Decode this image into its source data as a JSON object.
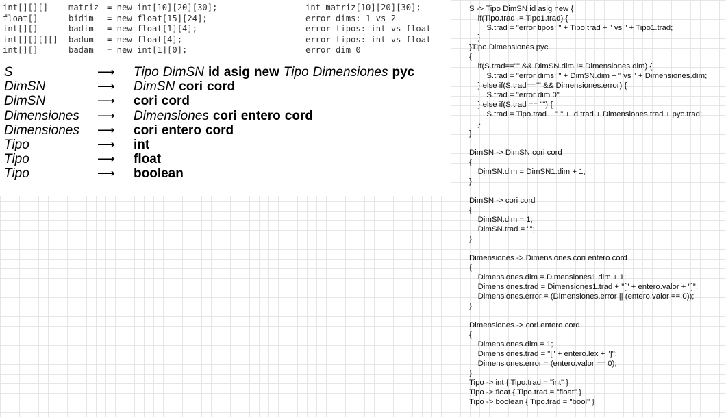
{
  "declarations": [
    {
      "type": "int[][][]",
      "name": "matriz",
      "expr": "= new int[10][20][30];",
      "result": "int matriz[10][20][30];"
    },
    {
      "type": "float[]",
      "name": "bidim",
      "expr": "= new float[15][24];",
      "result": "error dims: 1 vs 2"
    },
    {
      "type": "int[][]",
      "name": "badim",
      "expr": "= new float[1][4];",
      "result": "error tipos: int vs float"
    },
    {
      "type": "int[][][][]",
      "name": "badum",
      "expr": "= new float[4];",
      "result": "error tipos: int vs float"
    },
    {
      "type": "int[][]",
      "name": "badam",
      "expr": "= new int[1][0];",
      "result": "error dim 0"
    }
  ],
  "grammar": [
    {
      "lhs": "S",
      "arrow": "⟶",
      "rhs": [
        {
          "t": "Tipo",
          "k": "nt"
        },
        {
          "t": "DimSN",
          "k": "nt"
        },
        {
          "t": "id",
          "k": "t"
        },
        {
          "t": "asig",
          "k": "t"
        },
        {
          "t": "new",
          "k": "t"
        },
        {
          "t": "Tipo",
          "k": "nt"
        },
        {
          "t": "Dimensiones",
          "k": "nt"
        },
        {
          "t": "pyc",
          "k": "t"
        }
      ]
    },
    {
      "lhs": "DimSN",
      "arrow": "⟶",
      "rhs": [
        {
          "t": "DimSN",
          "k": "nt"
        },
        {
          "t": "cori",
          "k": "t"
        },
        {
          "t": "cord",
          "k": "t"
        }
      ]
    },
    {
      "lhs": "DimSN",
      "arrow": "⟶",
      "rhs": [
        {
          "t": "cori",
          "k": "t"
        },
        {
          "t": "cord",
          "k": "t"
        }
      ]
    },
    {
      "lhs": "Dimensiones",
      "arrow": "⟶",
      "rhs": [
        {
          "t": "Dimensiones",
          "k": "nt"
        },
        {
          "t": "cori",
          "k": "t"
        },
        {
          "t": "entero",
          "k": "t"
        },
        {
          "t": "cord",
          "k": "t"
        }
      ]
    },
    {
      "lhs": "Dimensiones",
      "arrow": "⟶",
      "rhs": [
        {
          "t": "cori",
          "k": "t"
        },
        {
          "t": "entero",
          "k": "t"
        },
        {
          "t": "cord",
          "k": "t"
        }
      ]
    },
    {
      "lhs": "Tipo",
      "arrow": "⟶",
      "rhs": [
        {
          "t": "int",
          "k": "t"
        }
      ]
    },
    {
      "lhs": "Tipo",
      "arrow": "⟶",
      "rhs": [
        {
          "t": "float",
          "k": "t"
        }
      ]
    },
    {
      "lhs": "Tipo",
      "arrow": "⟶",
      "rhs": [
        {
          "t": "boolean",
          "k": "t"
        }
      ]
    }
  ],
  "semantics": [
    "S -> Tipo DimSN id asig new {",
    "    if(Tipo.trad != Tipo1.trad) {",
    "        S.trad = \"error tipos: \" + Tipo.trad + \" vs \" + Tipo1.trad;",
    "    }",
    "}Tipo Dimensiones pyc",
    "{",
    "    if(S.trad==\"\" && DimSN.dim != Dimensiones.dim) {",
    "        S.trad = \"error dims: \" + DimSN.dim + \" vs \" + Dimensiones.dim;",
    "    } else if(S.trad==\"\" && Dimensiones.error) {",
    "        S.trad = \"error dim 0\"",
    "    } else if(S.trad == \"\") {",
    "        S.trad = Tipo.trad + \" \" + id.trad + Dimensiones.trad + pyc.trad;",
    "    }",
    "}",
    "",
    "DimSN -> DimSN cori cord",
    "{",
    "    DimSN.dim = DimSN1.dim + 1;",
    "}",
    "",
    "DimSN -> cori cord",
    "{",
    "    DimSN.dim = 1;",
    "    DimSN.trad = \"\";",
    "}",
    "",
    "Dimensiones -> Dimensiones cori entero cord",
    "{",
    "    Dimensiones.dim = Dimensiones1.dim + 1;",
    "    Dimensiones.trad = Dimensiones1.trad + \"[\" + entero.valor + \"]\";",
    "    Dimensiones.error = (Dimensiones.error || (entero.valor == 0));",
    "}",
    "",
    "Dimensiones -> cori entero cord",
    "{",
    "    Dimensiones.dim = 1;",
    "    Dimensiones.trad = \"[\" + entero.lex + \"]\";",
    "    Dimensiones.error = (entero.valor == 0);",
    "}",
    "Tipo -> int { Tipo.trad = \"int\" }",
    "Tipo -> float { Tipo.trad = \"float\" }",
    "Tipo -> boolean { Tipo.trad = \"bool\" }"
  ]
}
